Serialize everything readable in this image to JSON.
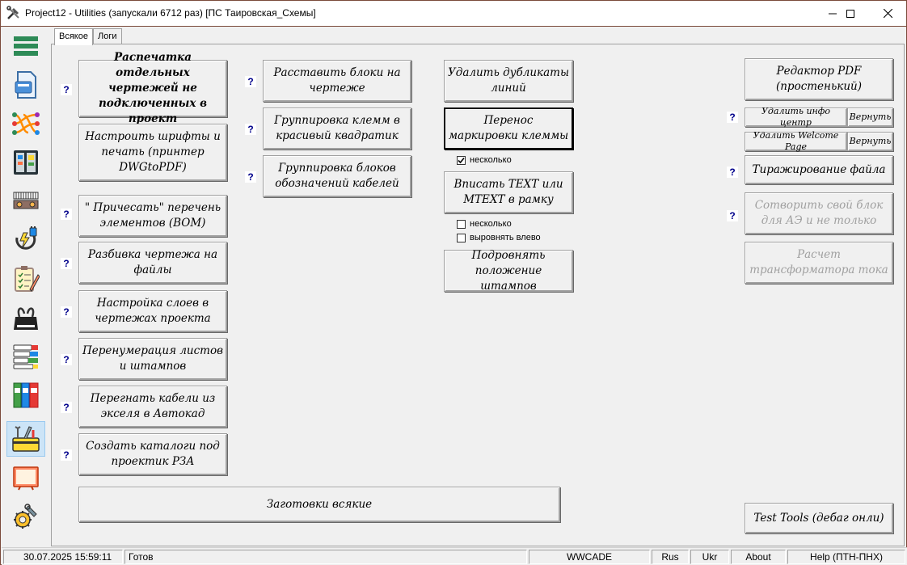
{
  "window": {
    "title": "Project12 - Utilities (запускали 6712 раз) [ПС Таировская_Схемы]"
  },
  "sidebar": {
    "items": [
      {
        "icon": "menu-icon"
      },
      {
        "icon": "document-icon"
      },
      {
        "icon": "network-icon"
      },
      {
        "icon": "cabinet-icon"
      },
      {
        "icon": "terminal-block-icon"
      },
      {
        "icon": "power-icon"
      },
      {
        "icon": "checklist-icon"
      },
      {
        "icon": "binder-clip-icon"
      },
      {
        "icon": "labels-icon"
      },
      {
        "icon": "folders-icon"
      },
      {
        "icon": "toolbox-icon",
        "selected": true
      },
      {
        "icon": "board-icon"
      },
      {
        "icon": "gear-wrench-icon"
      }
    ]
  },
  "tabs": [
    {
      "label": "Всякое",
      "active": true
    },
    {
      "label": "Логи",
      "active": false
    }
  ],
  "col1": {
    "print_separate": "Распечатка отдельных чертежей не подключенных в проект",
    "setup_fonts": "Настроить шрифты и печать (принтер DWGtoPDF)",
    "comb_bom": "\" Причесать\"  перечень элементов (BOM)",
    "split_drawing": "Разбивка чертежа на файлы",
    "layers_setup": "Настройка слоев в чертежах проекта",
    "renumber_sheets": "Перенумерация листов и штампов",
    "cables_excel": "Перегнать кабели из экселя в Автокад",
    "create_catalogs": "Создать каталоги под проектик РЗА"
  },
  "col2": {
    "place_blocks": "Расставить блоки на чертеже",
    "group_terminals": "Группировка клемм в красивый квадратик",
    "group_cable_blocks": "Группировка блоков обозначений кабелей"
  },
  "col3": {
    "delete_duplicates": "Удалить дубликаты линий",
    "move_terminal_marking": "Перенос маркировки клеммы",
    "several_1": "несколько",
    "fit_text": "Вписать TEXT или MTEXT в рамку",
    "several_2": "несколько",
    "align_left": "выровнять влево",
    "adjust_stamps": "Подровнять положение штампов"
  },
  "checkboxes": {
    "several_1_checked": true,
    "several_2_checked": false,
    "align_left_checked": false
  },
  "col4": {
    "pdf_editor": "Редактор PDF (простенький)",
    "delete_info_center": "Удалить инфо центр",
    "restore_1": "Вернуть",
    "delete_welcome_page": "Удалить Welcome Page",
    "restore_2": "Вернуть",
    "replicate_file": "Тиражирование файла",
    "create_block": "Сотворить свой блок для АЭ и не только",
    "ct_calc": "Расчет трансформатора тока",
    "test_tools": "Test Tools (дебаг онли)"
  },
  "bottom": {
    "templates": "Заготовки всякие"
  },
  "help_mark": "?",
  "statusbar": {
    "datetime": "30.07.2025 15:59:11",
    "status": "Готов",
    "app": "WWCADE",
    "lang_rus": "Rus",
    "lang_ukr": "Ukr",
    "about": "About",
    "help": "Help (ПТН-ПНХ)"
  }
}
